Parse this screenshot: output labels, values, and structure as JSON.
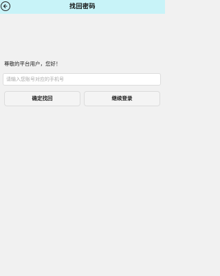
{
  "header": {
    "title": "找回密码"
  },
  "main": {
    "greeting": "尊敬的平台用户，您好！",
    "phone_input": {
      "value": "",
      "placeholder": "请输入您账号对应的手机号"
    },
    "confirm_button_label": "确定找回",
    "continue_login_button_label": "继续登录"
  },
  "colors": {
    "header_bg": "#c8f3f8",
    "page_bg": "#f1f1f1"
  },
  "icons": {
    "back": "back-arrow-icon"
  }
}
